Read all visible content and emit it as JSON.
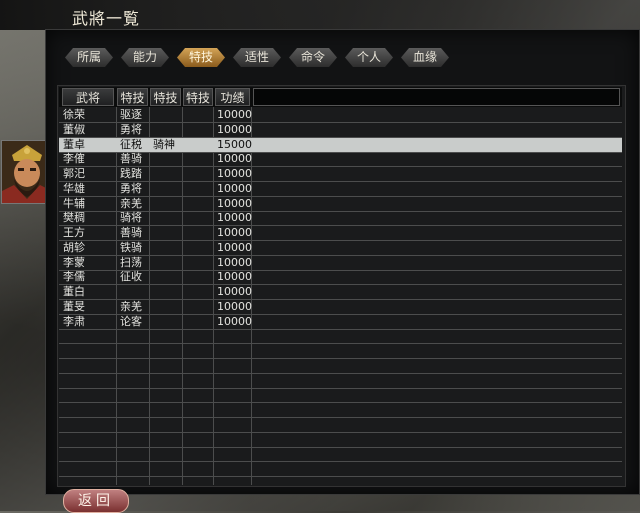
{
  "window": {
    "title": "武將一覧"
  },
  "tabs": [
    {
      "label": "所属",
      "active": false
    },
    {
      "label": "能力",
      "active": false
    },
    {
      "label": "特技",
      "active": true
    },
    {
      "label": "适性",
      "active": false
    },
    {
      "label": "命令",
      "active": false
    },
    {
      "label": "个人",
      "active": false
    },
    {
      "label": "血缘",
      "active": false
    }
  ],
  "table": {
    "columns": [
      "武将",
      "特技",
      "特技",
      "特技",
      "功绩"
    ],
    "rows": [
      {
        "name": "徐荣",
        "skill1": "驱逐",
        "skill2": "",
        "skill3": "",
        "merit": "10000",
        "selected": false
      },
      {
        "name": "董俶",
        "skill1": "勇将",
        "skill2": "",
        "skill3": "",
        "merit": "10000",
        "selected": false
      },
      {
        "name": "董卓",
        "skill1": "征税",
        "skill2": "骑神",
        "skill3": "",
        "merit": "15000",
        "selected": true
      },
      {
        "name": "李傕",
        "skill1": "善骑",
        "skill2": "",
        "skill3": "",
        "merit": "10000",
        "selected": false
      },
      {
        "name": "郭汜",
        "skill1": "践踏",
        "skill2": "",
        "skill3": "",
        "merit": "10000",
        "selected": false
      },
      {
        "name": "华雄",
        "skill1": "勇将",
        "skill2": "",
        "skill3": "",
        "merit": "10000",
        "selected": false
      },
      {
        "name": "牛辅",
        "skill1": "亲羌",
        "skill2": "",
        "skill3": "",
        "merit": "10000",
        "selected": false
      },
      {
        "name": "樊稠",
        "skill1": "骑将",
        "skill2": "",
        "skill3": "",
        "merit": "10000",
        "selected": false
      },
      {
        "name": "王方",
        "skill1": "善骑",
        "skill2": "",
        "skill3": "",
        "merit": "10000",
        "selected": false
      },
      {
        "name": "胡轸",
        "skill1": "铁骑",
        "skill2": "",
        "skill3": "",
        "merit": "10000",
        "selected": false
      },
      {
        "name": "李蒙",
        "skill1": "扫荡",
        "skill2": "",
        "skill3": "",
        "merit": "10000",
        "selected": false
      },
      {
        "name": "李儒",
        "skill1": "征收",
        "skill2": "",
        "skill3": "",
        "merit": "10000",
        "selected": false
      },
      {
        "name": "董白",
        "skill1": "",
        "skill2": "",
        "skill3": "",
        "merit": "10000",
        "selected": false
      },
      {
        "name": "董旻",
        "skill1": "亲羌",
        "skill2": "",
        "skill3": "",
        "merit": "10000",
        "selected": false
      },
      {
        "name": "李肃",
        "skill1": "论客",
        "skill2": "",
        "skill3": "",
        "merit": "10000",
        "selected": false
      }
    ]
  },
  "back_button": {
    "label": "返回"
  },
  "colors": {
    "selected_row": "#c9cccb",
    "active_tab": "#c79445"
  }
}
